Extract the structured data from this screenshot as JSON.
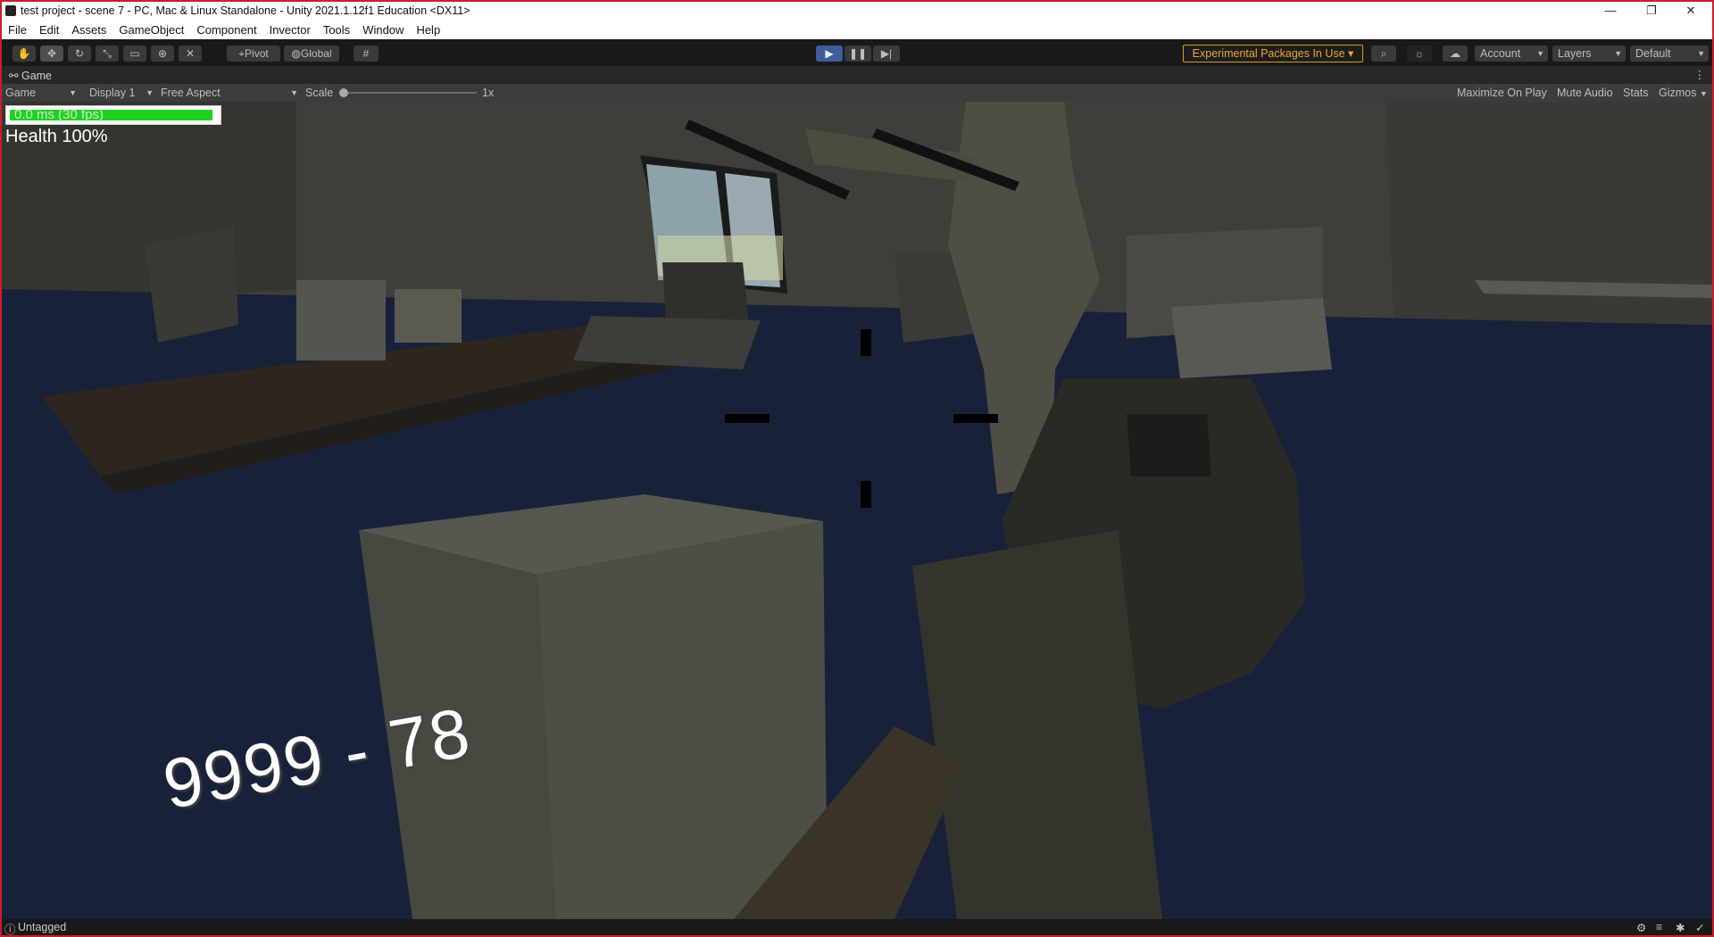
{
  "window": {
    "title": "test project - scene 7 - PC, Mac & Linux Standalone - Unity 2021.1.12f1 Education <DX11>",
    "controls": {
      "minimize": "—",
      "restore": "❐",
      "close": "✕"
    }
  },
  "menu": [
    "File",
    "Edit",
    "Assets",
    "GameObject",
    "Component",
    "Invector",
    "Tools",
    "Window",
    "Help"
  ],
  "toolbar": {
    "tools": [
      "hand-tool",
      "move-tool",
      "rotate-tool",
      "scale-tool",
      "rect-tool",
      "transform-tool",
      "custom-tool"
    ],
    "pivot_label": "Pivot",
    "global_label": "Global",
    "experimental_label": "Experimental Packages In Use ▾",
    "account_label": "Account",
    "layers_label": "Layers",
    "layout_label": "Default",
    "colors": {
      "play_active": "#3e5d9a",
      "experimental": "#e9a834"
    }
  },
  "game_tab": {
    "label": "Game"
  },
  "game_toolbar": {
    "view_select": "Game",
    "display_select": "Display 1",
    "aspect_select": "Free Aspect",
    "scale_label": "Scale",
    "scale_value": "1x",
    "maximize_label": "Maximize On Play",
    "mute_label": "Mute Audio",
    "stats_label": "Stats",
    "gizmos_label": "Gizmos"
  },
  "hud": {
    "fps_text": "0.0 ms (30 fps)",
    "fps_fill": 0.98,
    "health_text": "Health 100%",
    "damage_text": "9999 - 78",
    "colors": {
      "fps_bar": "#1ed21e",
      "health": "#ffffff"
    }
  },
  "status": {
    "text": "Untagged"
  }
}
